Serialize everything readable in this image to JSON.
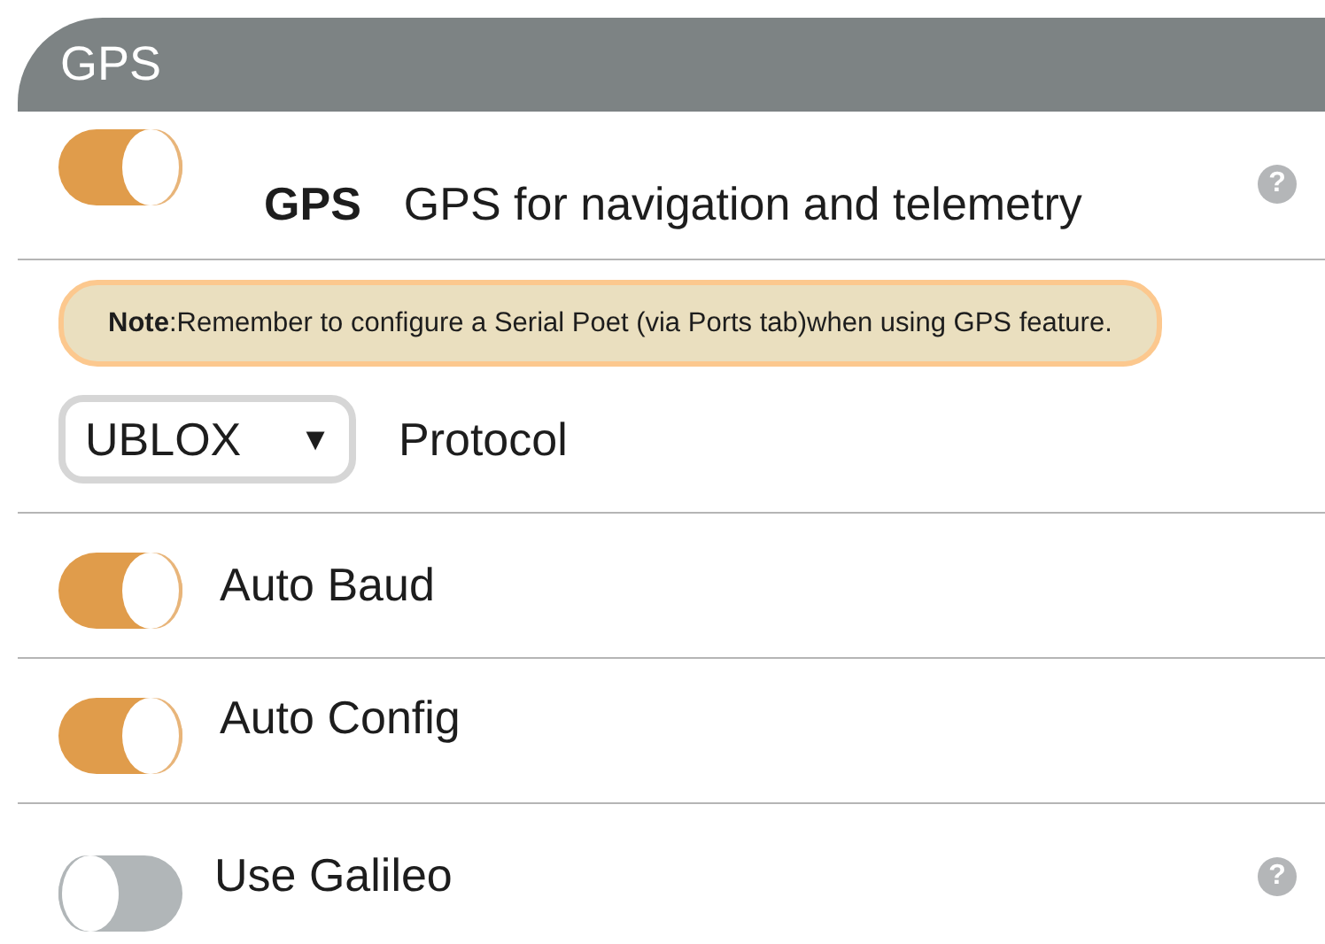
{
  "header": {
    "title": "GPS"
  },
  "gps": {
    "on": true,
    "name": "GPS",
    "description": "GPS for navigation and telemetry",
    "help": "?"
  },
  "note": {
    "text": "**Note**:Remember to configure a Serial Poet (via Ports tab)when using GPS feature."
  },
  "protocol": {
    "value": "UBLOX",
    "caret": "▼",
    "label": "Protocol"
  },
  "settings": [
    {
      "label": "Auto Baud",
      "on": true
    },
    {
      "label": "Auto Config",
      "on": true
    },
    {
      "label": "Use Galileo",
      "on": false,
      "help": "?"
    }
  ]
}
